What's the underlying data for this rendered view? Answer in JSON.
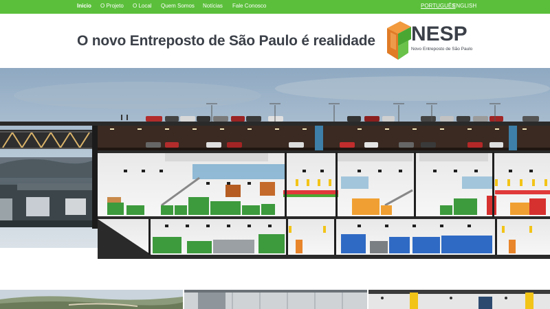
{
  "nav": {
    "items": [
      {
        "label": "Inicio",
        "active": true
      },
      {
        "label": "O Projeto",
        "active": false
      },
      {
        "label": "O Local",
        "active": false
      },
      {
        "label": "Quem Somos",
        "active": false
      },
      {
        "label": "Notícias",
        "active": false
      },
      {
        "label": "Fale Conosco",
        "active": false
      }
    ],
    "languages": [
      {
        "label": "PORTUGUÊS",
        "active": true
      },
      {
        "label": "ENGLISH",
        "active": false
      }
    ]
  },
  "header": {
    "headline": "O novo Entreposto de São Paulo é realidade",
    "logo": {
      "word": "NESP",
      "tagline": "Novo Entreposto de São Paulo"
    }
  },
  "colors": {
    "brand_green": "#5bbf3b",
    "logo_orange": "#e07b26",
    "logo_green": "#4aa832",
    "text_dark": "#3b4048"
  },
  "hero": {
    "image": "warehouse-cross-section-illustration"
  },
  "gallery": {
    "thumbnails": [
      "aerial-landscape-photo",
      "interior-warehouse-photo",
      "corridor-render-photo"
    ]
  }
}
